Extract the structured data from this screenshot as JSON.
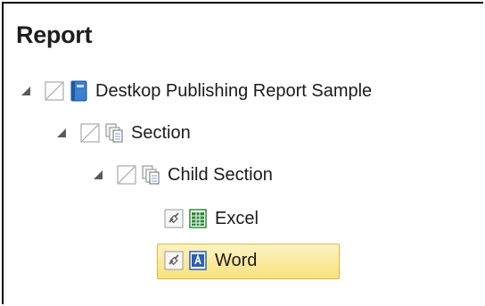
{
  "panel": {
    "title": "Report"
  },
  "tree": {
    "items": [
      {
        "label": "Destkop Publishing Report Sample",
        "icon": "report-book-icon",
        "expanded": true,
        "selected": false
      },
      {
        "label": "Section",
        "icon": "section-pages-icon",
        "expanded": true,
        "selected": false
      },
      {
        "label": "Child Section",
        "icon": "section-pages-icon",
        "expanded": true,
        "selected": false
      },
      {
        "label": "Excel",
        "icon": "excel-icon",
        "expanded": false,
        "selected": false
      },
      {
        "label": "Word",
        "icon": "word-icon",
        "expanded": false,
        "selected": true
      }
    ]
  },
  "colors": {
    "selection_fill": "#f9e27b",
    "selection_border": "#e3b836",
    "excel_green": "#2e8b3a",
    "word_blue": "#2b5fb4"
  }
}
